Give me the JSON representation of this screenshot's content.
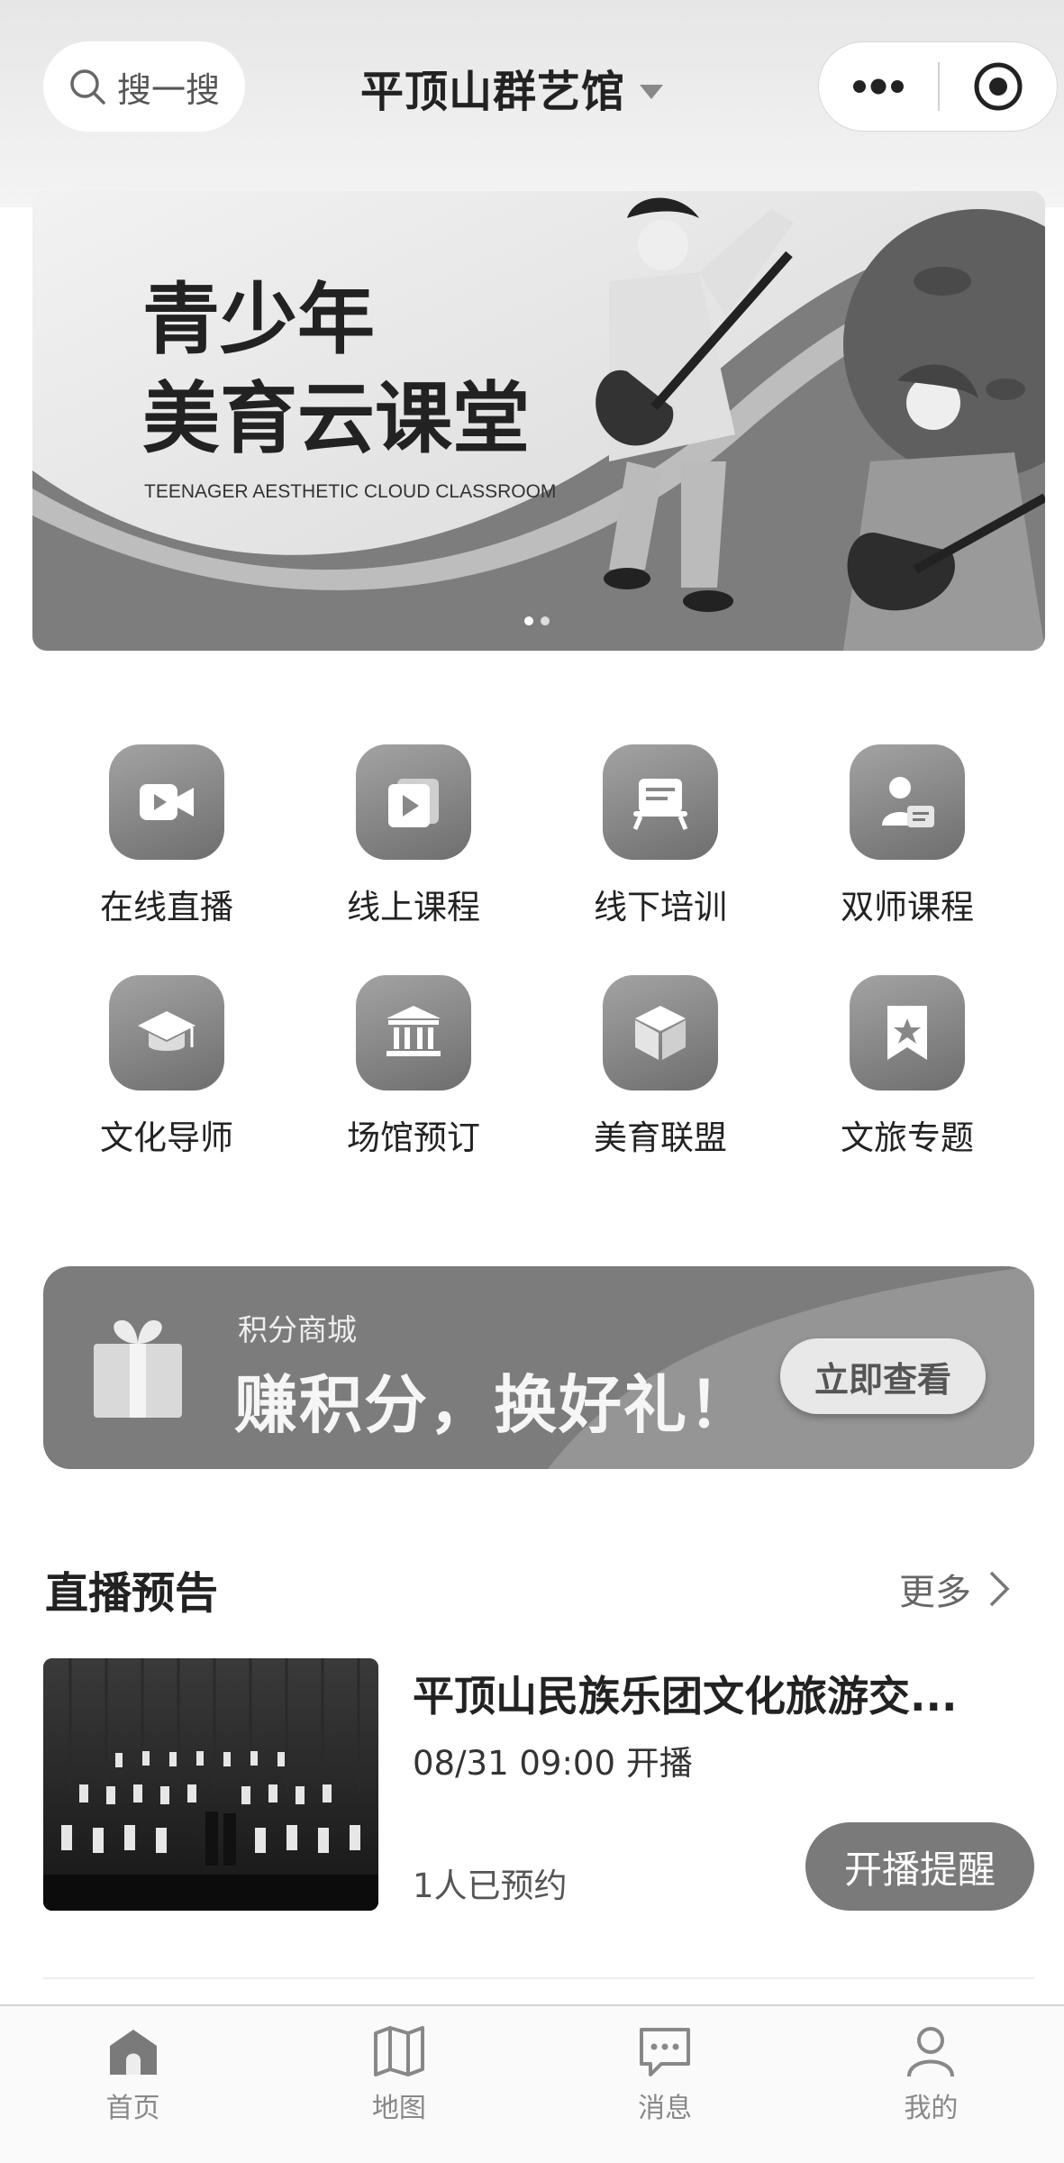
{
  "header": {
    "search_label": "搜一搜",
    "title": "平顶山群艺馆"
  },
  "banner": {
    "title_line1": "青少年",
    "title_line2": "美育云课堂",
    "subtitle": "TEENAGER AESTHETIC CLOUD CLASSROOM",
    "slide_count": 2,
    "active_slide": 1
  },
  "grid": [
    {
      "label": "在线直播",
      "icon": "video-camera-icon"
    },
    {
      "label": "线上课程",
      "icon": "play-cards-icon"
    },
    {
      "label": "线下培训",
      "icon": "desk-icon"
    },
    {
      "label": "双师课程",
      "icon": "teacher-badge-icon"
    },
    {
      "label": "文化导师",
      "icon": "graduation-cap-icon"
    },
    {
      "label": "场馆预订",
      "icon": "building-columns-icon"
    },
    {
      "label": "美育联盟",
      "icon": "cube-icon"
    },
    {
      "label": "文旅专题",
      "icon": "bookmark-star-icon"
    }
  ],
  "points": {
    "small_label": "积分商城",
    "headline": "赚积分，换好礼！",
    "button_label": "立即查看"
  },
  "live_section": {
    "title": "直播预告",
    "more_label": "更多",
    "item": {
      "title": "平顶山民族乐团文化旅游交...",
      "time": "08/31 09:00 开播",
      "reserved": "1人已预约",
      "remind_label": "开播提醒"
    }
  },
  "tabbar": [
    {
      "label": "首页",
      "icon": "home-icon",
      "active": true
    },
    {
      "label": "地图",
      "icon": "map-icon",
      "active": false
    },
    {
      "label": "消息",
      "icon": "message-icon",
      "active": false
    },
    {
      "label": "我的",
      "icon": "user-icon",
      "active": false
    }
  ]
}
